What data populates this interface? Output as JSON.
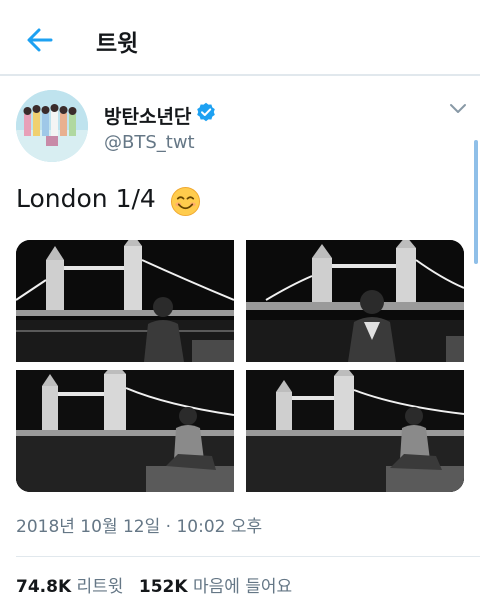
{
  "header": {
    "title": "트윗",
    "back_icon": "arrow-left-icon",
    "accent": "#1da1f2"
  },
  "tweet": {
    "display_name": "방탄소년단",
    "handle": "@BTS_twt",
    "verified_icon": "verified-badge-icon",
    "text": "London 1/4",
    "emoji": "smiling-face-emoji",
    "photo_count": 4,
    "timestamp": "2018년 10월 12일 · 10:02 오후"
  },
  "stats": {
    "retweets_count": "74.8K",
    "retweets_label": "리트윗",
    "likes_count": "152K",
    "likes_label": "마음에 들어요"
  }
}
